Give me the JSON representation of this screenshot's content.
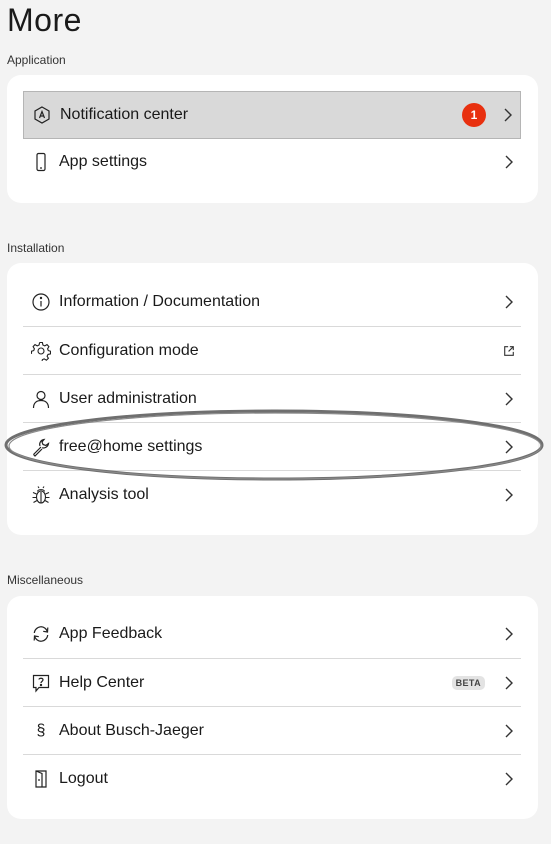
{
  "page": {
    "title": "More"
  },
  "sections": {
    "application": {
      "label": "Application",
      "items": [
        {
          "label": "Notification center",
          "icon": "notification-icon",
          "badge": "1"
        },
        {
          "label": "App settings",
          "icon": "phone-icon"
        }
      ]
    },
    "installation": {
      "label": "Installation",
      "items": [
        {
          "label": "Information / Documentation",
          "icon": "info-icon"
        },
        {
          "label": "Configuration mode",
          "icon": "gear-icon"
        },
        {
          "label": "User administration",
          "icon": "user-icon"
        },
        {
          "label": "free@home settings",
          "icon": "wrench-icon"
        },
        {
          "label": "Analysis tool",
          "icon": "bug-icon"
        }
      ]
    },
    "miscellaneous": {
      "label": "Miscellaneous",
      "items": [
        {
          "label": "App Feedback",
          "icon": "refresh-icon"
        },
        {
          "label": "Help Center",
          "icon": "help-icon",
          "tag": "BETA"
        },
        {
          "label": "About Busch-Jaeger",
          "icon": "paragraph-icon"
        },
        {
          "label": "Logout",
          "icon": "logout-icon"
        }
      ]
    }
  },
  "colors": {
    "background": "#f3f3f3",
    "card": "#ffffff",
    "highlight": "#d9d9d9",
    "badge": "#e8300f",
    "annotation_oval": "#6f6f6f"
  }
}
